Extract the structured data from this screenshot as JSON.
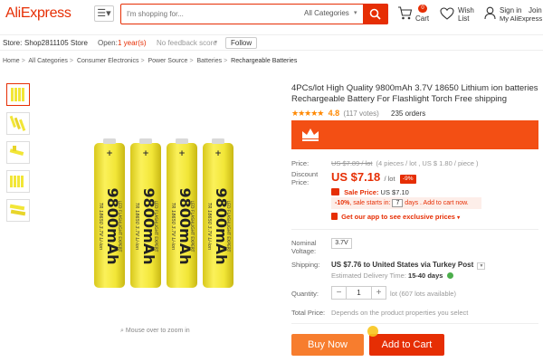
{
  "header": {
    "logo": "AliExpress",
    "menu_icon": "☰▾",
    "search_placeholder": "I'm shopping for...",
    "category": "All Categories",
    "cart_label": "Cart",
    "cart_count": "0",
    "wishlist_label_1": "Wish",
    "wishlist_label_2": "List",
    "signin_label": "Sign in",
    "join_label": "Join",
    "account_label": "My AliExpress"
  },
  "store": {
    "store_label": "Store:",
    "store_name": "Shop2811105 Store",
    "open_label": "Open:",
    "open_value": "1 year(s)",
    "feedback": "No feedback score",
    "follow_label": "Follow"
  },
  "breadcrumb": [
    "Home",
    "All Categories",
    "Consumer Electronics",
    "Power Source",
    "Batteries",
    "Rechargeable Batteries"
  ],
  "gallery": {
    "zoom_hint": "Mouse over to zoom in",
    "battery_text_1": "9800mAh",
    "battery_text_2": "LED FLASHLIGHT EXPERT",
    "battery_text_3": "TR 18650 3.7V Li-ion"
  },
  "product": {
    "title": "4PCs/lot High Quality 9800mAh 3.7V 18650 Lithium ion batteries Rechargeable Battery For Flashlight Torch Free shipping",
    "stars": "★★★★★",
    "rating": "4.8",
    "votes": "(117 votes)",
    "orders": "235 orders"
  },
  "pricing": {
    "price_label": "Price:",
    "original_price": "US $7.89 / lot",
    "original_detail": "(4 pieces / lot , US $ 1.80 / piece )",
    "discount_label_1": "Discount",
    "discount_label_2": "Price:",
    "discount_price": "US $7.18",
    "discount_unit": "/ lot",
    "discount_badge": "-9%",
    "sale_price_label": "Sale Price:",
    "sale_price": "US $7.10",
    "countdown_pct": "-10%",
    "countdown_text_1": ", sale starts in:",
    "countdown_days": "7",
    "countdown_text_2": "days . Add to cart now.",
    "get_app": "Get our app to see exclusive prices",
    "get_app_arrow": "▾"
  },
  "details": {
    "nominal_label_1": "Nominal",
    "nominal_label_2": "Voltage:",
    "voltage_option": "3.7V",
    "shipping_label": "Shipping:",
    "shipping_value": "US $7.76 to United States via Turkey Post",
    "delivery_label": "Estimated Delivery Time:",
    "delivery_value": "15-40 days",
    "quantity_label": "Quantity:",
    "quantity_minus": "−",
    "quantity_value": "1",
    "quantity_plus": "+",
    "quantity_available": "lot (607 lots available)",
    "total_label": "Total Price:",
    "total_value": "Depends on the product properties you select"
  },
  "actions": {
    "buy_now": "Buy Now",
    "add_to_cart": "Add to Cart"
  },
  "colors": {
    "brand": "#e62e04",
    "buy_now": "#f77d2e",
    "battery": "#f2e637"
  }
}
